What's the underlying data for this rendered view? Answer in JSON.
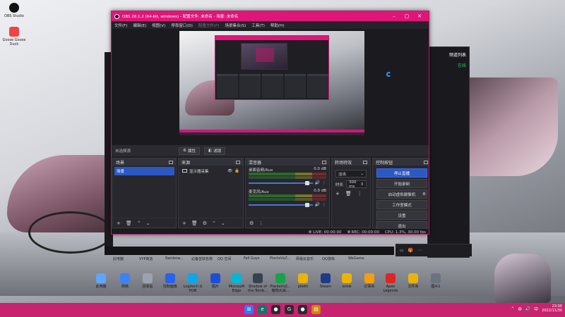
{
  "desktop": {
    "top_icons": [
      {
        "label": "OBS Studio"
      },
      {
        "label": "Goose Goose Duck"
      }
    ],
    "mid_row": [
      "此电脑",
      "VYP商店",
      "Rainbow...",
      "必备音效名称",
      "QQ 空间",
      "Fall Guys",
      "PlantsVsZ...",
      "网易云音乐",
      "QQ游戏",
      "WeGame"
    ],
    "bottom_row": [
      {
        "label": "此电脑"
      },
      {
        "label": "网络"
      },
      {
        "label": "回收站"
      },
      {
        "label": "控制面板"
      },
      {
        "label": "Logitech G HUB"
      },
      {
        "label": "图片"
      },
      {
        "label": "Microsoft Edge"
      },
      {
        "label": "Shadow of the Tomb..."
      },
      {
        "label": "PlantsVsZ... 植物大战..."
      },
      {
        "label": "photo"
      },
      {
        "label": "Steam"
      },
      {
        "label": "snow"
      },
      {
        "label": "记事本"
      },
      {
        "label": "Apex Legends"
      },
      {
        "label": "文件夹"
      },
      {
        "label": "图片2"
      }
    ]
  },
  "bg_window": {
    "title": "频道列表",
    "status": "在线"
  },
  "obs": {
    "title": "OBS 28.1.2 (64-bit, windows) - 配置文件: 未命名 - 场景: 未命名",
    "menu": [
      "文件(F)",
      "编辑(E)",
      "视图(V)",
      "停靠窗口(D)",
      "配置文件(P)",
      "场景集合(S)",
      "工具(T)",
      "帮助(H)"
    ],
    "toolstrip": {
      "label": "未选择源",
      "properties": "属性",
      "filters": "滤镜"
    },
    "docks": {
      "scenes": {
        "title": "场景",
        "items": [
          "场景"
        ]
      },
      "sources": {
        "title": "来源",
        "items": [
          "显示器采集"
        ]
      },
      "mixer": {
        "title": "混音器",
        "channels": [
          {
            "name": "桌面音频/Aux",
            "db": "0.0 dB",
            "level": 0.92
          },
          {
            "name": "麦克风/Aux",
            "db": "0.0 dB",
            "level": 0.92
          }
        ]
      },
      "transitions": {
        "title": "转场特效",
        "selected": "淡出",
        "duration_label": "时长",
        "duration": "300 ms"
      },
      "controls": {
        "title": "控制按钮",
        "buttons": [
          "停止直播",
          "开始录制",
          "启动虚拟摄像机",
          "工作室模式",
          "设置",
          "退出"
        ]
      }
    },
    "status": {
      "live": "LIVE: 00:00:00",
      "rec": "REC: 00:00:00",
      "cpu": "CPU: 1.3%, 30.00 fps"
    }
  },
  "taskbar": {
    "time": "23:00",
    "date": "2022/11/30"
  }
}
